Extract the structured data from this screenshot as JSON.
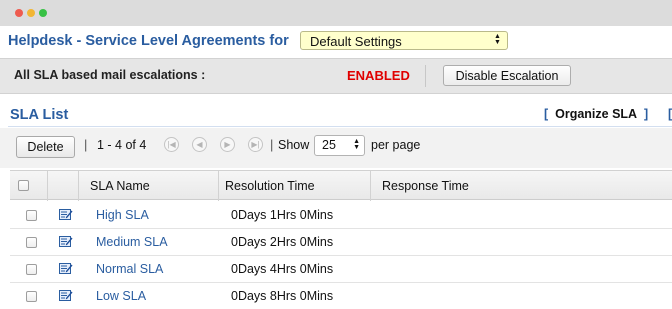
{
  "header": {
    "title": "Helpdesk - Service Level Agreements for",
    "settings_select": "Default Settings"
  },
  "escalation": {
    "label": "All SLA based mail escalations :",
    "status": "ENABLED",
    "status_color": "#e00000",
    "button": "Disable Escalation"
  },
  "sla_list": {
    "title": "SLA List",
    "organize": "Organize SLA",
    "bracket_open": "[",
    "bracket_close": "]"
  },
  "toolbar": {
    "delete": "Delete",
    "separator": "|",
    "range": "1 - 4 of 4",
    "show": "Show",
    "per_page_value": "25",
    "per_page_label": "per page"
  },
  "table": {
    "columns": [
      "SLA Name",
      "Resolution Time",
      "Response Time"
    ],
    "rows": [
      {
        "name": "High SLA",
        "resolution": "0Days 1Hrs 0Mins",
        "response": ""
      },
      {
        "name": "Medium SLA",
        "resolution": "0Days 2Hrs 0Mins",
        "response": ""
      },
      {
        "name": "Normal SLA",
        "resolution": "0Days 4Hrs 0Mins",
        "response": ""
      },
      {
        "name": "Low SLA",
        "resolution": "0Days 8Hrs 0Mins",
        "response": ""
      }
    ]
  },
  "icons": {
    "nav": [
      "first-page-icon",
      "previous-page-icon",
      "next-page-icon",
      "last-page-icon"
    ],
    "edit": "edit-icon"
  },
  "colors": {
    "accent": "#2a5da0",
    "select_bg": "#ffffcc"
  }
}
